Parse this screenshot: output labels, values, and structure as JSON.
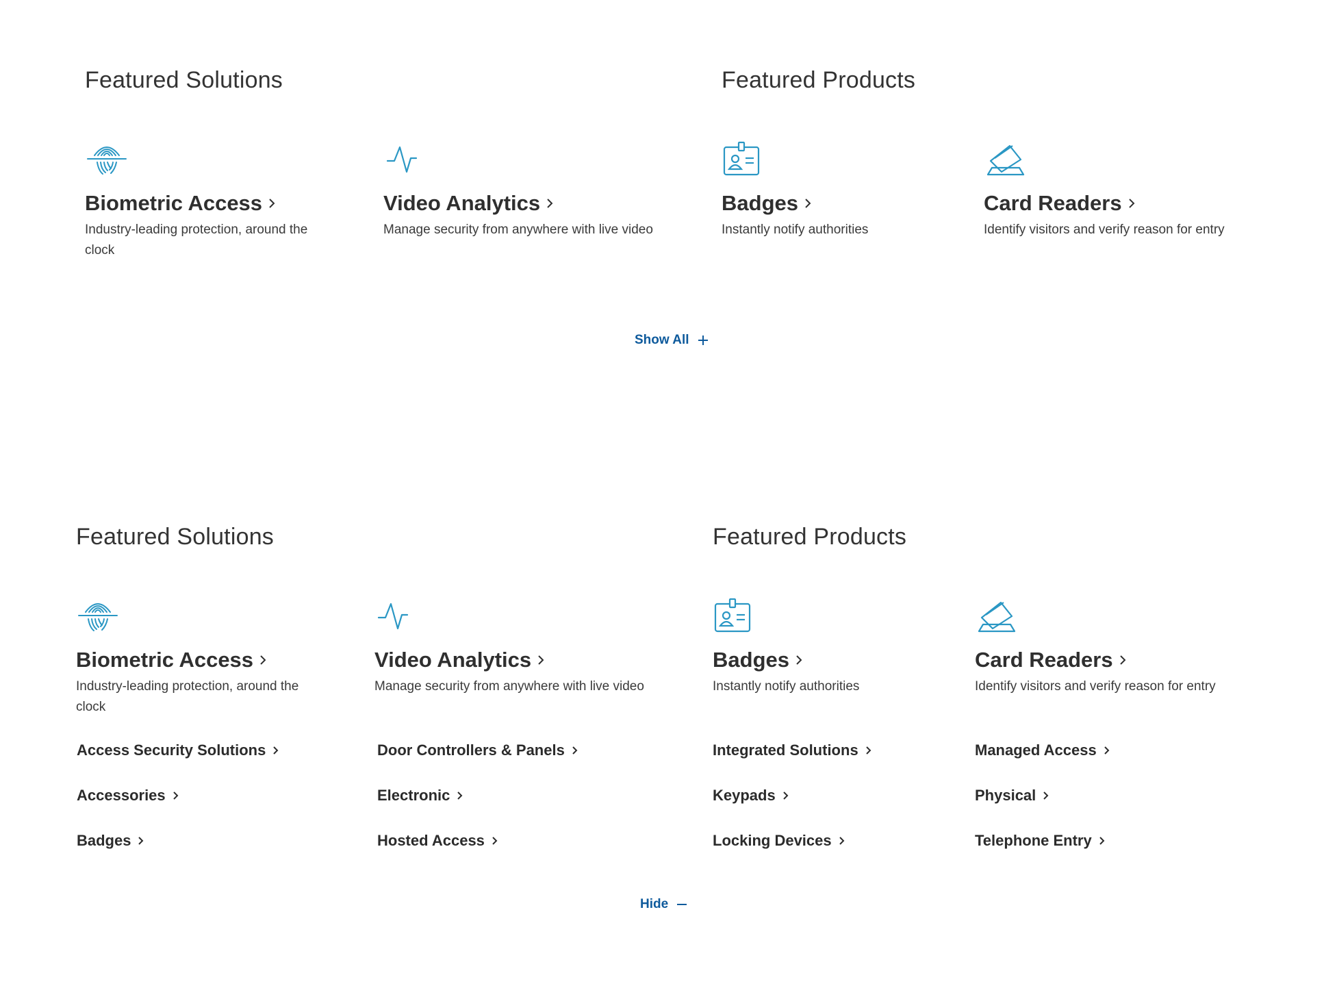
{
  "accent_color": "#2a97c4",
  "link_color": "#0e5a9c",
  "collapsed": {
    "solutions_title": "Featured Solutions",
    "products_title": "Featured Products",
    "features": [
      {
        "icon": "fingerprint-icon",
        "title": "Biometric Access",
        "description": "Industry-leading protection, around the clock"
      },
      {
        "icon": "pulse-icon",
        "title": "Video Analytics",
        "description": "Manage security from anywhere with live video"
      },
      {
        "icon": "id-badge-icon",
        "title": "Badges",
        "description": "Instantly notify authorities"
      },
      {
        "icon": "card-reader-icon",
        "title": "Card Readers",
        "description": "Identify visitors and verify reason for entry"
      }
    ],
    "toggle_label": "Show All",
    "toggle_icon": "plus-icon"
  },
  "expanded": {
    "solutions_title": "Featured Solutions",
    "products_title": "Featured Products",
    "features": [
      {
        "icon": "fingerprint-icon",
        "title": "Biometric Access",
        "description": "Industry-leading protection, around the clock"
      },
      {
        "icon": "pulse-icon",
        "title": "Video Analytics",
        "description": "Manage security from anywhere with live video"
      },
      {
        "icon": "id-badge-icon",
        "title": "Badges",
        "description": "Instantly notify authorities"
      },
      {
        "icon": "card-reader-icon",
        "title": "Card Readers",
        "description": "Identify visitors and verify reason for entry"
      }
    ],
    "link_columns": [
      [
        "Access Security Solutions",
        "Accessories",
        "Badges"
      ],
      [
        "Door Controllers & Panels",
        "Electronic",
        "Hosted Access"
      ],
      [
        "Integrated Solutions",
        "Keypads",
        "Locking Devices"
      ],
      [
        "Managed Access",
        "Physical",
        "Telephone Entry"
      ]
    ],
    "toggle_label": "Hide",
    "toggle_icon": "minus-icon"
  }
}
